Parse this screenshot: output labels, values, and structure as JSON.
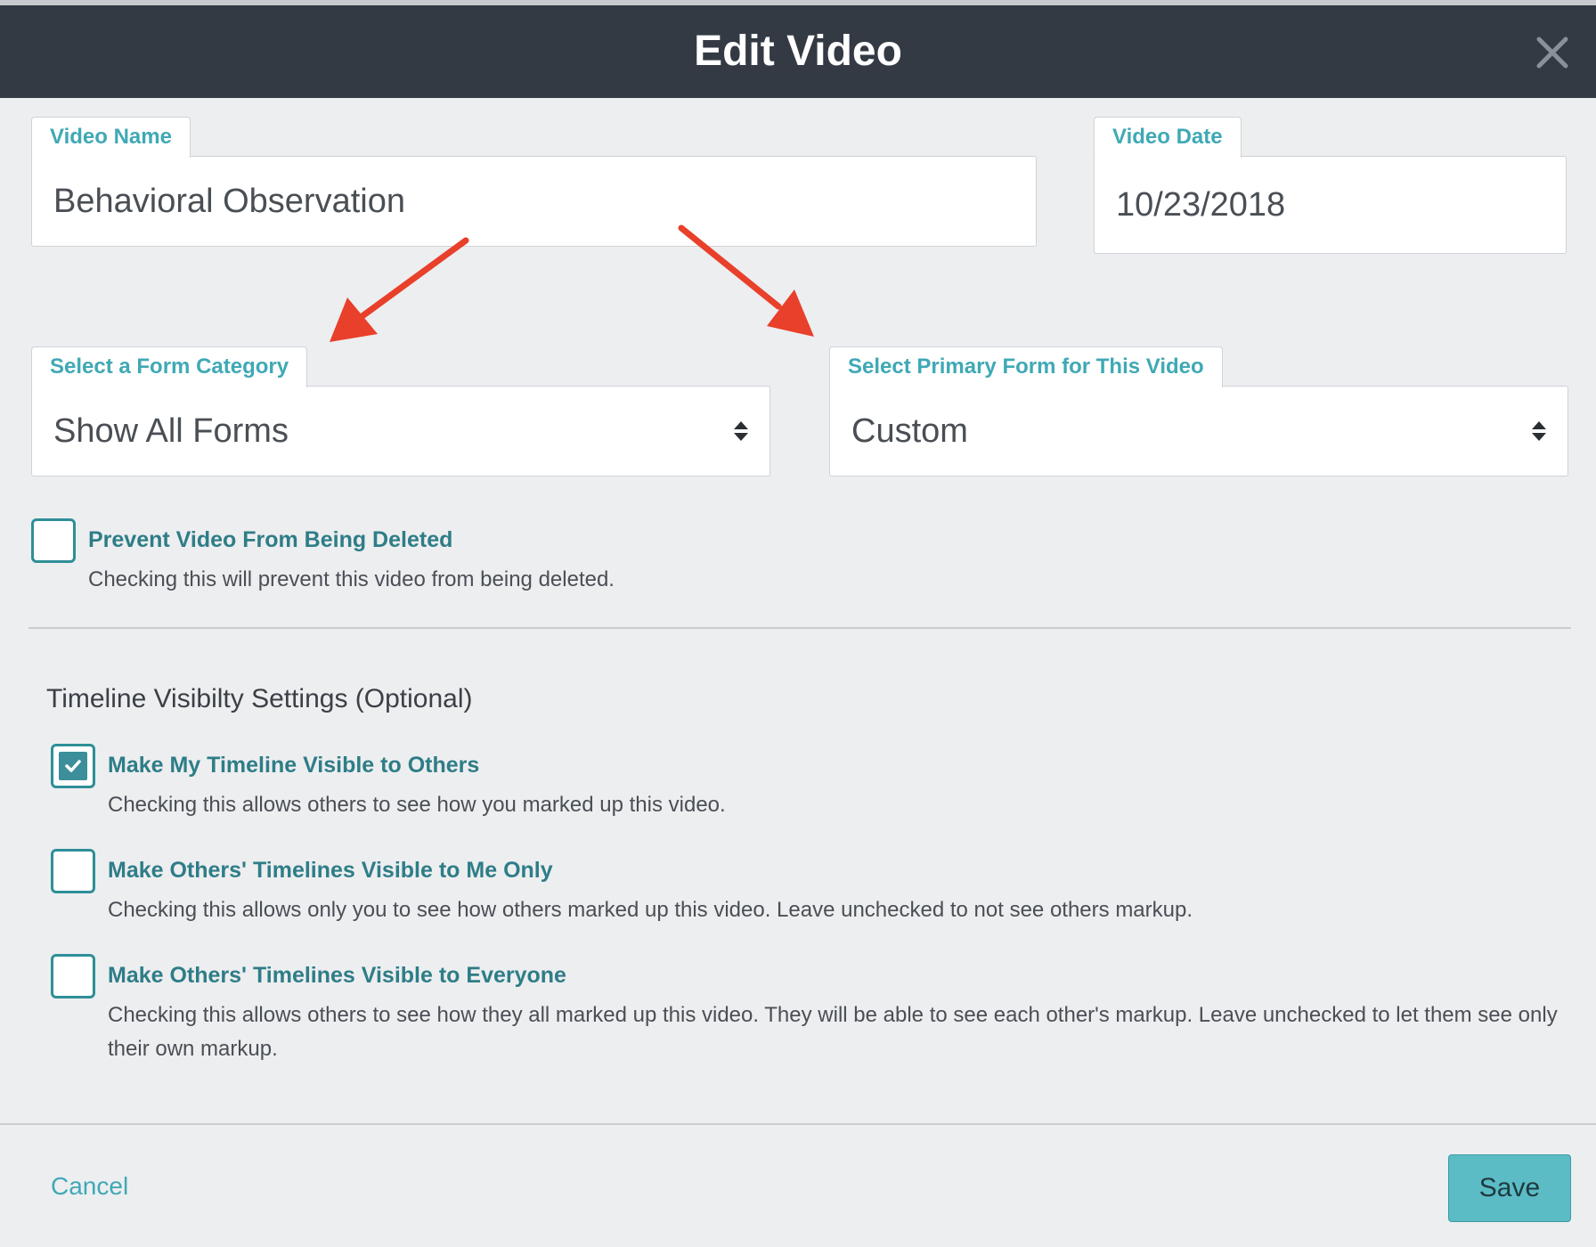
{
  "modal": {
    "title": "Edit Video"
  },
  "fields": {
    "video_name": {
      "label": "Video Name",
      "value": "Behavioral Observation"
    },
    "video_date": {
      "label": "Video Date",
      "value": "10/23/2018"
    },
    "form_category": {
      "label": "Select a Form Category",
      "value": "Show All Forms"
    },
    "primary_form": {
      "label": "Select Primary Form for This Video",
      "value": "Custom"
    }
  },
  "prevent_delete": {
    "label": "Prevent Video From Being Deleted",
    "description": "Checking this will prevent this video from being deleted.",
    "checked": false
  },
  "timeline": {
    "title": "Timeline Visibilty Settings (Optional)",
    "options": [
      {
        "label": "Make My Timeline Visible to Others",
        "description": "Checking this allows others to see how you marked up this video.",
        "checked": true
      },
      {
        "label": "Make Others' Timelines Visible to Me Only",
        "description": "Checking this allows only you to see how others marked up this video. Leave unchecked to not see others markup.",
        "checked": false
      },
      {
        "label": "Make Others' Timelines Visible to Everyone",
        "description": "Checking this allows others to see how they all marked up this video. They will be able to see each other's markup. Leave unchecked to let them see only their own markup.",
        "checked": false
      }
    ]
  },
  "footer": {
    "cancel_label": "Cancel",
    "save_label": "Save"
  },
  "icons": {
    "close": "close-icon",
    "select": "updown-caret-icon",
    "check": "check-icon",
    "annotation": "red-arrow-icon"
  },
  "colors": {
    "header_bg": "#333a43",
    "accent": "#3fa9b5",
    "label_teal": "#2e7d87",
    "save_bg": "#5bbcc5",
    "annotation_arrow": "#e8402a"
  }
}
